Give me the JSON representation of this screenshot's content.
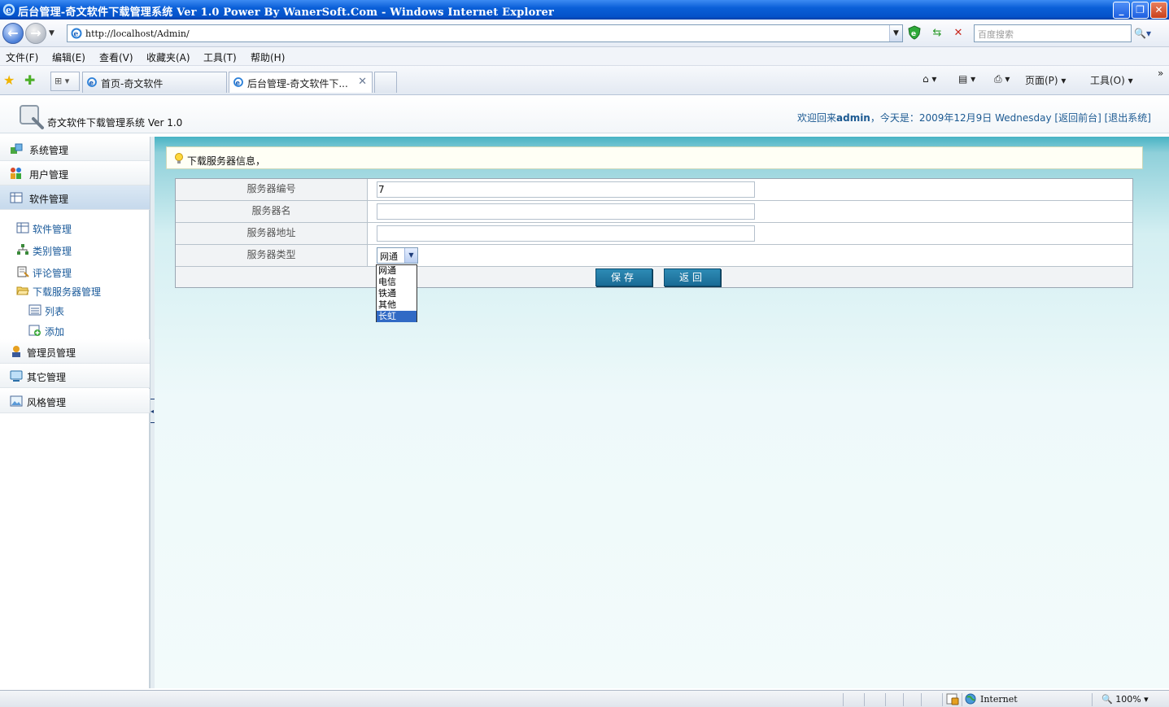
{
  "window": {
    "title": "后台管理-奇文软件下载管理系统 Ver 1.0 Power By WanerSoft.Com - Windows Internet Explorer",
    "minimize": "_",
    "restore": "❐",
    "close": "✕"
  },
  "browser": {
    "back": "←",
    "forward": "→",
    "nav_dropdown": "▼",
    "url": "http://localhost/Admin/",
    "search_placeholder": "百度搜索",
    "search_btn": "🔍▾",
    "menu": [
      "文件(F)",
      "编辑(E)",
      "查看(V)",
      "收藏夹(A)",
      "工具(T)",
      "帮助(H)"
    ],
    "tabs": [
      {
        "label": "首页-奇文软件",
        "active": false
      },
      {
        "label": "后台管理-奇文软件下...",
        "active": true
      }
    ],
    "quick_tabs": "⊞ ▾",
    "tab_close": "✕",
    "command": {
      "home": "⌂ ▾",
      "feeds": "▤ ▾",
      "print": "⎙ ▾",
      "page": "页面(P) ▾",
      "tools": "工具(O) ▾",
      "more": "»"
    }
  },
  "app": {
    "system_name": "奇文软件下载管理系统 Ver 1.0",
    "welcome_prefix": "欢迎回来",
    "username": "admin",
    "today_text": "，今天是：2009年12月9日 Wednesday",
    "back_to_front": "[返回前台]",
    "logout": "[退出系统]"
  },
  "sidebar": {
    "items": [
      {
        "label": "系统管理",
        "icon": "system-icon"
      },
      {
        "label": "用户管理",
        "icon": "users-icon"
      },
      {
        "label": "软件管理",
        "icon": "software-icon",
        "selected": true
      },
      {
        "label": "管理员管理",
        "icon": "admin-icon"
      },
      {
        "label": "其它管理",
        "icon": "other-icon"
      },
      {
        "label": "风格管理",
        "icon": "style-icon"
      }
    ],
    "sub_items": [
      {
        "label": "软件管理"
      },
      {
        "label": "类别管理"
      },
      {
        "label": "评论管理"
      },
      {
        "label": "下载服务器管理"
      },
      {
        "label": "列表"
      },
      {
        "label": "添加"
      }
    ]
  },
  "main": {
    "notice": "下载服务器信息，",
    "form": {
      "fields": [
        {
          "label": "服务器编号",
          "value": "7"
        },
        {
          "label": "服务器名",
          "value": ""
        },
        {
          "label": "服务器地址",
          "value": ""
        },
        {
          "label": "服务器类型",
          "value": "网通"
        }
      ],
      "save_label": "保存",
      "back_label": "返回",
      "type_options": [
        "网通",
        "电信",
        "铁通",
        "其他",
        "长虹"
      ],
      "highlighted_option": "长虹"
    }
  },
  "statusbar": {
    "zone": "Internet",
    "zoom": "100%",
    "zoom_drop": "▾"
  },
  "colors": {
    "title_blue": "#0552c9",
    "header_link": "#1c5a92",
    "button_teal": "#1a6b95",
    "highlight": "#316ac5"
  }
}
